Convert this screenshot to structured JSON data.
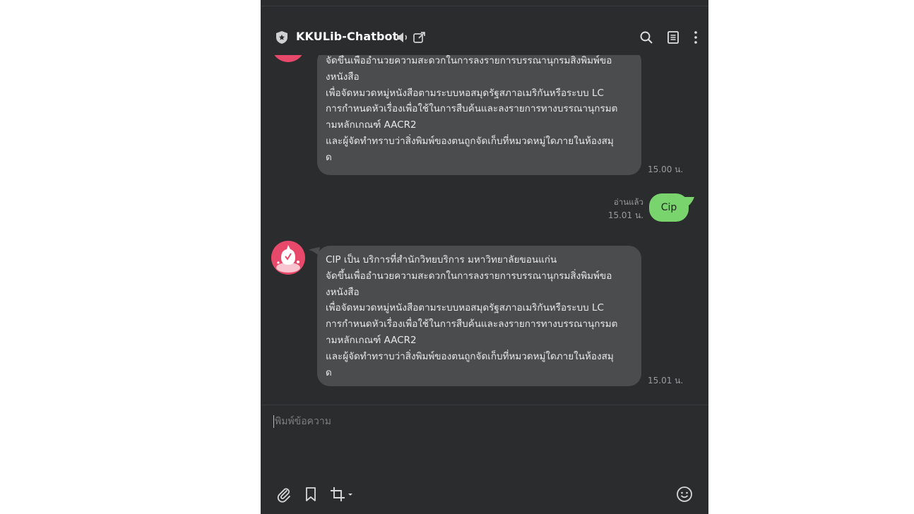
{
  "header": {
    "title": "KKULib-Chatbot",
    "icons": [
      "shield-icon",
      "speaker-icon",
      "external-link-icon",
      "search-icon",
      "notes-icon",
      "more-vertical-icon"
    ]
  },
  "messages": {
    "bot_1": {
      "lines": [
        "จัดขึ้นเพื่ออำนวยความสะดวกในการลงรายการบรรณานุกรมสิ่งพิมพ์ขอ",
        "งหนังสือ",
        "เพื่อจัดหมวดหมู่หนังสือตามระบบหอสมุดรัฐสภาอเมริกันหรือระบบ LC",
        "การกำหนดหัวเรื่องเพื่อใช้ในการสืบค้นและลงรายการทางบรรณานุกรมต",
        "ามหลักเกณฑ์ AACR2",
        "และผู้จัดทำทราบว่าสิ่งพิมพ์ของตนถูกจัดเก็บที่หมวดหมู่ใดภายในห้องสมุ",
        "ด"
      ],
      "time": "15.00 น."
    },
    "user_1": {
      "text": "Cip",
      "read_status": "อ่านแล้ว",
      "time": "15.01 น."
    },
    "bot_2": {
      "lines": [
        "CIP เป็น บริการที่สำนักวิทยบริการ มหาวิทยาลัยขอนแก่น",
        "จัดขึ้นเพื่ออำนวยความสะดวกในการลงรายการบรรณานุกรมสิ่งพิมพ์ขอ",
        "งหนังสือ",
        "เพื่อจัดหมวดหมู่หนังสือตามระบบหอสมุดรัฐสภาอเมริกันหรือระบบ LC",
        "การกำหนดหัวเรื่องเพื่อใช้ในการสืบค้นและลงรายการทางบรรณานุกรมต",
        "ามหลักเกณฑ์ AACR2",
        "และผู้จัดทำทราบว่าสิ่งพิมพ์ของตนถูกจัดเก็บที่หมวดหมู่ใดภายในห้องสมุ",
        "ด"
      ],
      "time": "15.01 น."
    }
  },
  "composer": {
    "placeholder": "พิมพ์ข้อความ",
    "icons": [
      "paperclip-icon",
      "bookmark-icon",
      "crop-icon",
      "emoji-icon"
    ]
  },
  "colors": {
    "window_bg": "#2b2c2e",
    "bubble_bg": "#4b4c4e",
    "sent_bubble_bg": "#79d46e",
    "avatar_bg": "#e8496a"
  }
}
